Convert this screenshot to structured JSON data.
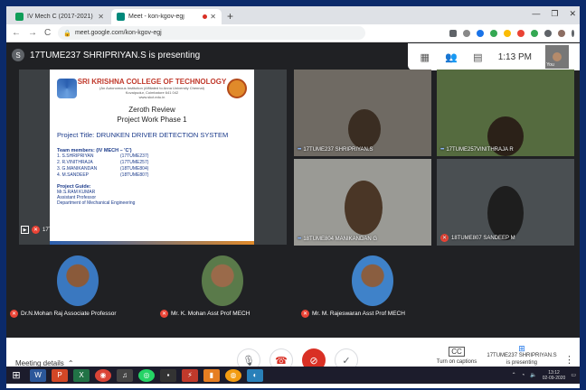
{
  "browser": {
    "tabs": [
      {
        "title": "IV Mech C (2017-2021) Project C",
        "favicon_color": "#0f9d58",
        "active": false
      },
      {
        "title": "Meet - kon-kgov-egj",
        "favicon_color": "#00897b",
        "active": true
      }
    ],
    "new_tab": "+",
    "url": "meet.google.com/kon-kgov-egj",
    "window_controls": [
      "—",
      "❐",
      "✕"
    ]
  },
  "meet": {
    "presenter_initial": "S",
    "presenter_text": "17TUME237 SHRIPRIYAN.S is presenting",
    "time": "1:13 PM",
    "you_label": "You",
    "slide": {
      "college": "SRI KRISHNA COLLEGE OF TECHNOLOGY",
      "sub1": "(An Autonomous Institution |Affiliated to Anna University Chennai)",
      "sub2": "Kovaipudur, Coimbatore 641 042",
      "sub3": "www.skct.edu.in",
      "review": "Zeroth Review",
      "phase": "Project Work Phase 1",
      "project_title": "Project Title: DRUNKEN DRIVER DETECTION SYSTEM",
      "team_heading": "Team members: (IV MECH – 'C')",
      "members": [
        {
          "name": "1.  S.SHRIPRIYAN",
          "id": "(17TUME237)"
        },
        {
          "name": "2.  R.VINITHRAJA",
          "id": "(17TUME257)"
        },
        {
          "name": "3.  G.MANIKANDAN",
          "id": "(18TUME804)"
        },
        {
          "name": "4.  M.SANDEEP",
          "id": "(18TUME807)"
        }
      ],
      "guide_heading": "Project Guide:",
      "guide_lines": [
        "Mr.S.RAM KUMAR",
        "Assistant Professor",
        "Department of Mechanical Engineering"
      ],
      "tile_name": "17T"
    },
    "participants": [
      {
        "name": "17TUME237 SHRIPRIYAN.S",
        "bg": "#6f6a63",
        "muted": false
      },
      {
        "name": "17TUME257VINITHRAJA R",
        "bg": "#556b3f",
        "muted": false
      },
      {
        "name": "18TUME804 MANIKANDAN G",
        "bg": "#9a9a95",
        "muted": false
      },
      {
        "name": "18TUME807 SANDEEP M",
        "bg": "#4a4f52",
        "muted": true
      }
    ],
    "bottom_participants": [
      {
        "name": "Dr.N.Mohan Raj Associate Professor",
        "color": "#3a78c0"
      },
      {
        "name": "Mr. K. Mohan Asst Prof MECH",
        "color": "#5a7a4a"
      },
      {
        "name": "Mr. M. Rajeswaran Asst Prof MECH",
        "color": "#3f82c9"
      }
    ],
    "controls": {
      "meeting_details": "Meeting details",
      "captions": "Turn on captions",
      "cc": "CC",
      "presenting_line1": "17TUME237 SHRIPRIYAN.S",
      "presenting_line2": "is presenting"
    }
  },
  "taskbar": {
    "apps": [
      {
        "label": "W",
        "color": "#2b579a"
      },
      {
        "label": "P",
        "color": "#d24726"
      },
      {
        "label": "X",
        "color": "#217346"
      },
      {
        "label": "◉",
        "color": "#db4437"
      },
      {
        "label": "♫",
        "color": "#444"
      },
      {
        "label": "◎",
        "color": "#25d366"
      },
      {
        "label": "▪",
        "color": "#333"
      },
      {
        "label": "⚡",
        "color": "#c0392b"
      },
      {
        "label": "▮",
        "color": "#e67e22"
      },
      {
        "label": "◍",
        "color": "#f39c12"
      },
      {
        "label": "◐",
        "color": "#2980b9"
      }
    ],
    "time": "13:12",
    "date": "02-09-2020"
  }
}
